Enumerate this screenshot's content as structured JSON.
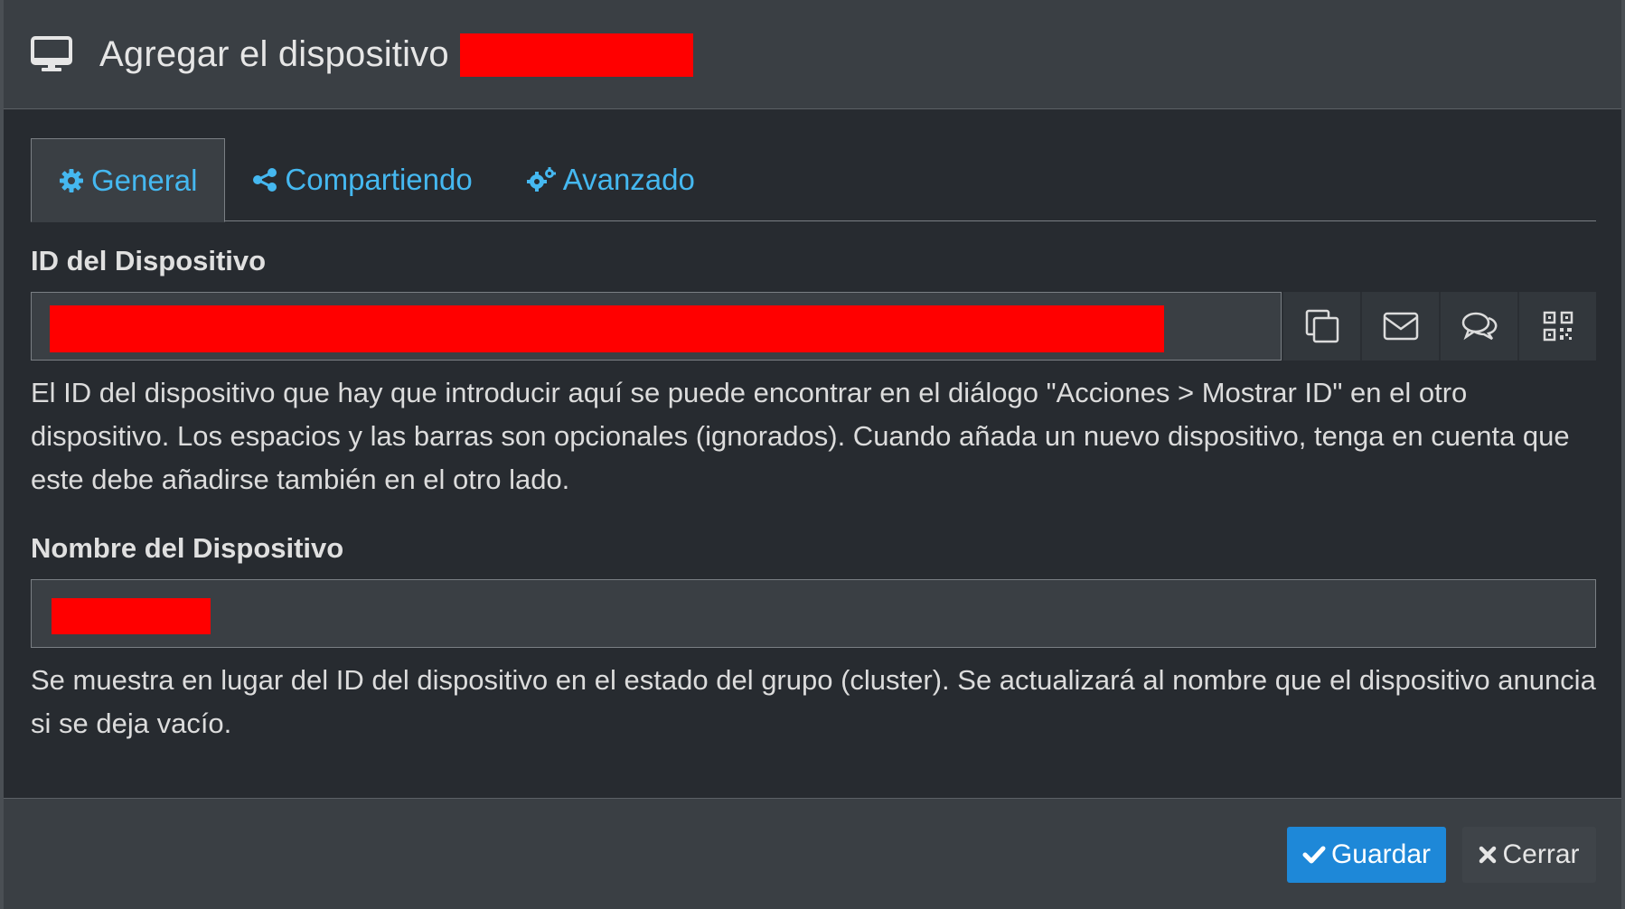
{
  "header": {
    "title": "Agregar el dispositivo",
    "icon": "monitor-icon"
  },
  "tabs": [
    {
      "label": "General",
      "icon": "gear-icon",
      "active": true
    },
    {
      "label": "Compartiendo",
      "icon": "share-icon",
      "active": false
    },
    {
      "label": "Avanzado",
      "icon": "gears-icon",
      "active": false
    }
  ],
  "device_id": {
    "label": "ID del Dispositivo",
    "help": "El ID del dispositivo que hay que introducir aquí se puede encontrar en el diálogo \"Acciones > Mostrar ID\" en el otro dispositivo. Los espacios y las barras son opcionales (ignorados). Cuando añada un nuevo dispositivo, tenga en cuenta que este debe añadirse también en el otro lado.",
    "actions": [
      "copy-icon",
      "email-icon",
      "chat-icon",
      "qr-code-icon"
    ]
  },
  "device_name": {
    "label": "Nombre del Dispositivo",
    "help": "Se muestra en lugar del ID del dispositivo en el estado del grupo (cluster). Se actualizará al nombre que el dispositivo anuncia si se deja vacío."
  },
  "footer": {
    "save_label": "Guardar",
    "close_label": "Cerrar"
  },
  "colors": {
    "accent": "#45b8f0",
    "primary_button": "#1e88d8",
    "redaction": "#ff0000"
  }
}
